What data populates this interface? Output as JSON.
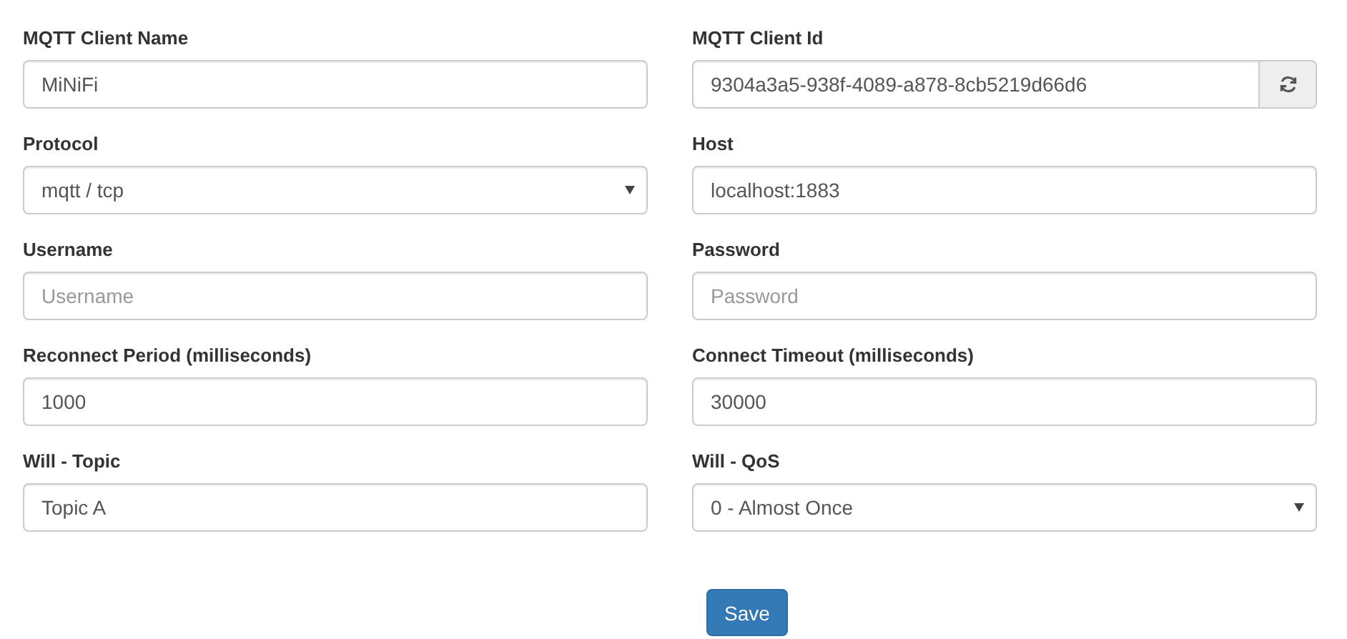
{
  "fields": [
    {
      "label": "MQTT Client Name",
      "kind": "text",
      "value": "MiNiFi"
    },
    {
      "label": "MQTT Client Id",
      "kind": "text-refresh",
      "value": "9304a3a5-938f-4089-a878-8cb5219d66d6"
    },
    {
      "label": "Protocol",
      "kind": "select",
      "value": "mqtt / tcp"
    },
    {
      "label": "Host",
      "kind": "text",
      "value": "localhost:1883"
    },
    {
      "label": "Username",
      "kind": "text",
      "placeholder": "Username"
    },
    {
      "label": "Password",
      "kind": "text",
      "placeholder": "Password"
    },
    {
      "label": "Reconnect Period (milliseconds)",
      "kind": "text",
      "value": "1000"
    },
    {
      "label": "Connect Timeout (milliseconds)",
      "kind": "text",
      "value": "30000"
    },
    {
      "label": "Will - Topic",
      "kind": "text",
      "value": "Topic A"
    },
    {
      "label": "Will - QoS",
      "kind": "select",
      "value": "0 - Almost Once"
    }
  ],
  "save_button": "Save"
}
